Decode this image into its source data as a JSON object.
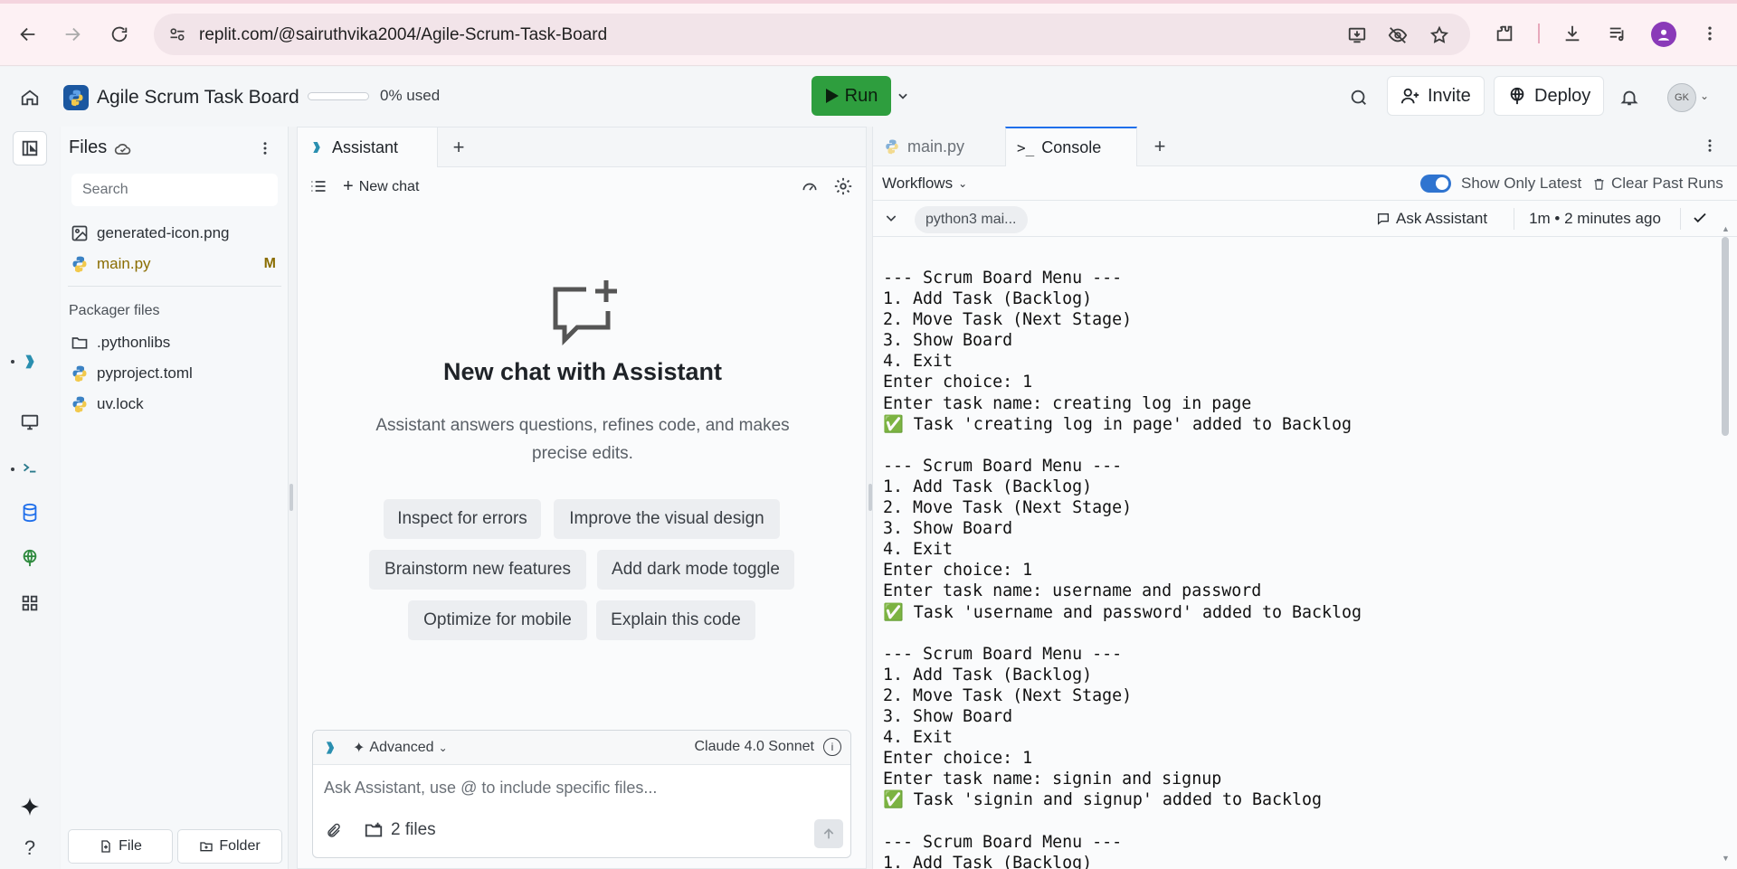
{
  "browser": {
    "url": "replit.com/@sairuthvika2004/Agile-Scrum-Task-Board"
  },
  "header": {
    "repl_name": "Agile Scrum Task Board",
    "usage_percent": 0,
    "usage_label": "0% used",
    "run_label": "Run",
    "invite_label": "Invite",
    "deploy_label": "Deploy",
    "user_initials": "GK"
  },
  "files": {
    "title": "Files",
    "search_placeholder": "Search",
    "items": [
      {
        "name": "generated-icon.png",
        "icon": "image-icon",
        "badge": ""
      },
      {
        "name": "main.py",
        "icon": "python-icon",
        "badge": "M"
      }
    ],
    "packager_label": "Packager files",
    "packager_items": [
      {
        "name": ".pythonlibs",
        "icon": "folder-icon"
      },
      {
        "name": "pyproject.toml",
        "icon": "python-icon"
      },
      {
        "name": "uv.lock",
        "icon": "python-icon"
      }
    ],
    "add_file_label": "File",
    "add_folder_label": "Folder"
  },
  "assistant": {
    "tab_label": "Assistant",
    "new_chat_label": "New chat",
    "empty_title": "New chat with Assistant",
    "empty_desc": "Assistant answers questions, refines code, and makes precise edits.",
    "suggestions": [
      "Inspect for errors",
      "Improve the visual design",
      "Brainstorm new features",
      "Add dark mode toggle",
      "Optimize for mobile",
      "Explain this code"
    ],
    "mode_label": "Advanced",
    "model_label": "Claude 4.0 Sonnet",
    "input_placeholder": "Ask Assistant, use @ to include specific files...",
    "files_label": "2 files"
  },
  "console": {
    "tabs": [
      {
        "label": "main.py"
      },
      {
        "label": "Console"
      }
    ],
    "workflows_label": "Workflows",
    "show_latest_label": "Show Only Latest",
    "show_latest_on": true,
    "clear_label": "Clear Past Runs",
    "run_chip": "python3 mai...",
    "ask_assistant_label": "Ask Assistant",
    "run_time": "1m • 2 minutes ago",
    "output": "--- Scrum Board Menu ---\n1. Add Task (Backlog)\n2. Move Task (Next Stage)\n3. Show Board\n4. Exit\nEnter choice: 1\nEnter task name: creating log in page\n✅ Task 'creating log in page' added to Backlog\n\n--- Scrum Board Menu ---\n1. Add Task (Backlog)\n2. Move Task (Next Stage)\n3. Show Board\n4. Exit\nEnter choice: 1\nEnter task name: username and password\n✅ Task 'username and password' added to Backlog\n\n--- Scrum Board Menu ---\n1. Add Task (Backlog)\n2. Move Task (Next Stage)\n3. Show Board\n4. Exit\nEnter choice: 1\nEnter task name: signin and signup\n✅ Task 'signin and signup' added to Backlog\n\n--- Scrum Board Menu ---\n1. Add Task (Backlog)"
  },
  "colors": {
    "run_green": "#2e9e3e",
    "accent_blue": "#1f6feb",
    "modified_yellow": "#8a6d00"
  }
}
